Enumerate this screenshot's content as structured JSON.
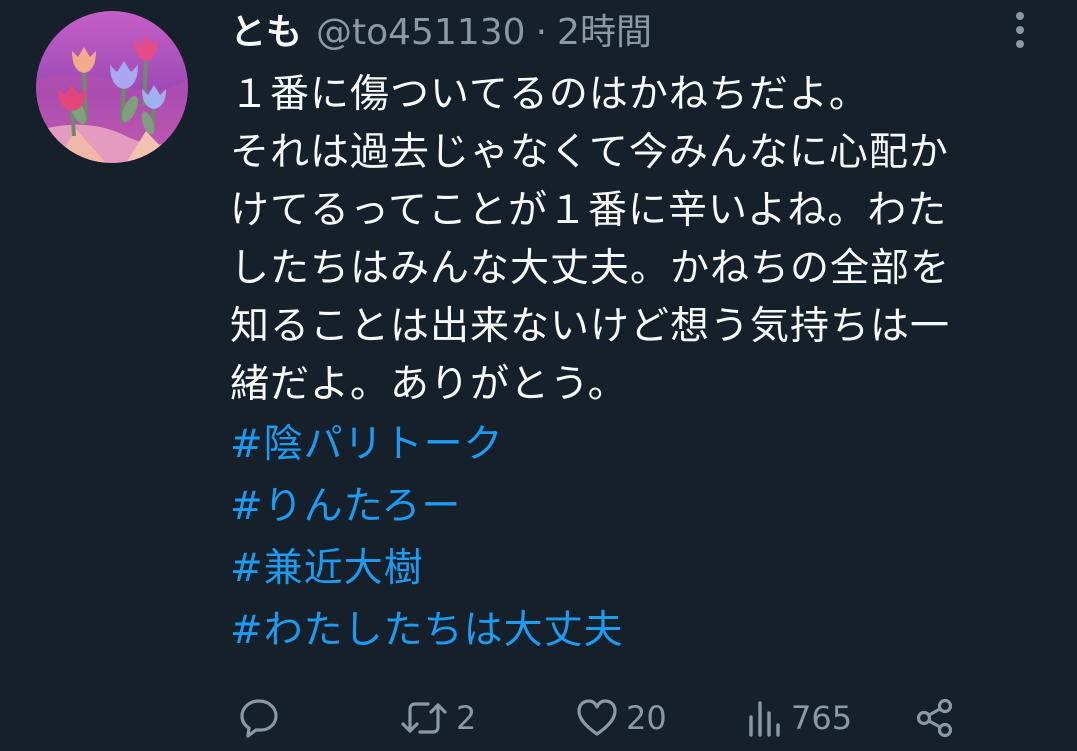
{
  "user": {
    "display_name": "とも",
    "handle": "@to451130",
    "separator": "·",
    "time": "2時間"
  },
  "tweet": {
    "lines": [
      "１番に傷ついてるのはかねちだよ。",
      "それは過去じゃなくて今みんなに心配か",
      "けてるってことが１番に辛いよね。わた",
      "したちはみんな大丈夫。かねちの全部を",
      "知ることは出来ないけど想う気持ちは一",
      "緒だよ。ありがとう。"
    ],
    "hashtags": [
      "#陰パリトーク",
      "#りんたろー",
      "#兼近大樹",
      "#わたしたちは大丈夫"
    ]
  },
  "actions": {
    "reply_icon": "speech-bubble-icon",
    "retweet_icon": "retweet-arrows-icon",
    "retweet_count": "2",
    "like_icon": "heart-icon",
    "like_count": "20",
    "views_icon": "bar-chart-icon",
    "views_count": "765",
    "share_icon": "share-nodes-icon"
  },
  "colors": {
    "background": "#15202b",
    "text": "#f7f9f9",
    "secondary": "#8b98a5",
    "hashtag": "#1d9bf0"
  }
}
